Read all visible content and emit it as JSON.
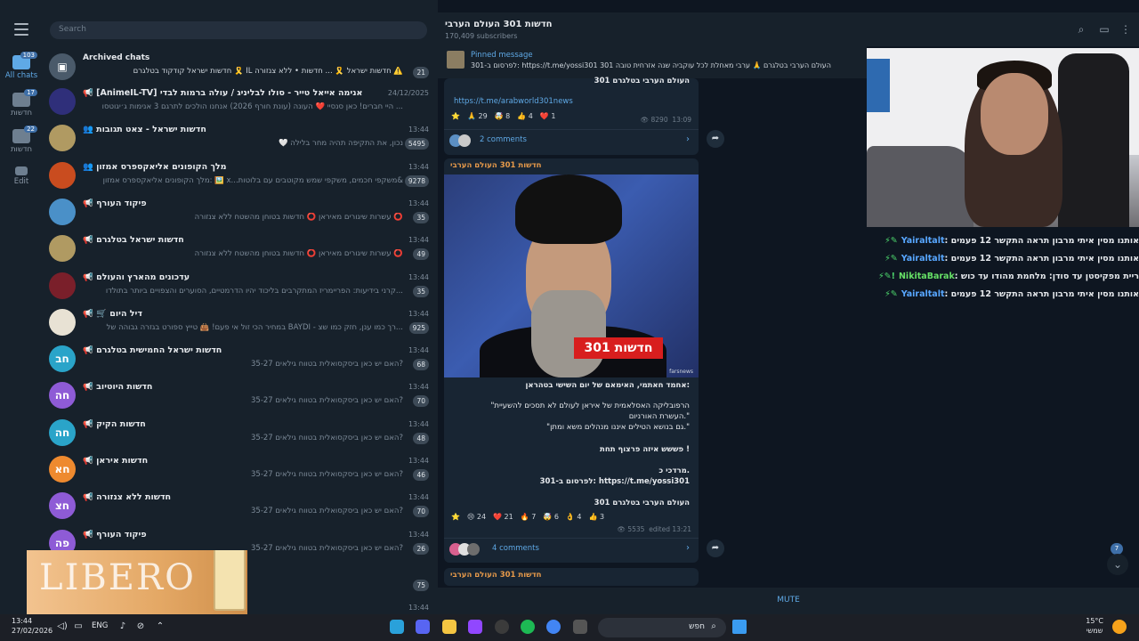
{
  "rail": {
    "folders": [
      {
        "label": "All chats",
        "badge": "103"
      },
      {
        "label": "חדשות",
        "badge": "17"
      },
      {
        "label": "חדשות",
        "badge": "22"
      },
      {
        "label": "Edit",
        "badge": ""
      }
    ]
  },
  "search": {
    "placeholder": "Search"
  },
  "archived": {
    "title": "Archived chats",
    "preview": "חדשות ישראל קודקוד בטלגרם 🎗️ IL חדשות ישראל 🎗️ ... חדשות • ללא צנזורה ⚠️",
    "badge": "21"
  },
  "chats": [
    {
      "title": "📢 [AnimeIL-TV] אנימה אייאל טייר - סולו לבליניג / עולה ברמות לבדי",
      "time": "24/12/2025",
      "preview": "היי חברים! כאן סנסיי ❤️ העונה (עונת חורף 2026) אנחנו הולכים לתרגם 3 אנימות ג׳יגוטסו ...",
      "badge": "",
      "avatar_text": "",
      "avatar_color": "#2f2f7a"
    },
    {
      "title": "👥 חדשות ישראל - צאט תגובות",
      "time": "13:44",
      "preview": "🤍 נכון, את התקיפה תהיה מחר בלילה",
      "badge": "5495",
      "avatar_text": "",
      "avatar_color": "#b09a62"
    },
    {
      "title": "👥 מלך הקופונים אליאקספרס אמזון",
      "time": "13:44",
      "preview": "מלך הקופונים אליאקספרס אמזון: 🖼️ x...משקפי חכמים, משקפי שמש מקוטבים עם בלוטות&",
      "badge": "9278",
      "avatar_text": "",
      "avatar_color": "#c94c1f"
    },
    {
      "title": "📢 פיקוד העורף",
      "time": "13:44",
      "preview": "עשרות שיגורים מאיראן ⭕ חדשות בטוחן מהשטח ללא צנזורה ⭕",
      "badge": "35",
      "avatar_text": "",
      "avatar_color": "#4a90c8"
    },
    {
      "title": "📢 חדשות ישראל בטלגרם",
      "time": "13:44",
      "preview": "עשרות שיגורים מאיראן ⭕ חדשות בטוחן מהשטח ללא צנזורה ⭕",
      "badge": "49",
      "avatar_text": "",
      "avatar_color": "#b09a62"
    },
    {
      "title": "📢 עדכונים מהארץ והעולם",
      "time": "13:44",
      "preview": "קרני בידיעות: הפריימריז המתקרבים בליכוד יהיו הדרמטיים, הסוערים והצפויים ביותר בתולדו...",
      "badge": "35",
      "avatar_text": "",
      "avatar_color": "#7a1f2a"
    },
    {
      "title": "📢 🛒 דיל היום",
      "time": "13:44",
      "preview": "במחיר הכי זול אי פעם! 👜 טייץ ספורט בגזרה גבוהה של BAYDI - רך כמו ענן, חזק כמו שצ...",
      "badge": "925",
      "avatar_text": "",
      "avatar_color": "#e8e2d4"
    },
    {
      "title": "📢 חדשות ישראל החמישית בטלגרם",
      "time": "13:44",
      "preview": "האם יש כאן ביסקסואלית בטווח גילאים 35-27?",
      "badge": "68",
      "avatar_text": "חב",
      "avatar_color": "#2aa4c9"
    },
    {
      "title": "📢 חדשות היוטיוב",
      "time": "13:44",
      "preview": "האם יש כאן ביסקסואלית בטווח גילאים 35-27?",
      "badge": "70",
      "avatar_text": "חה",
      "avatar_color": "#8e5bd6"
    },
    {
      "title": "📢 חדשות הקיק",
      "time": "13:44",
      "preview": "האם יש כאן ביסקסואלית בטווח גילאים 35-27?",
      "badge": "48",
      "avatar_text": "חה",
      "avatar_color": "#2aa4c9"
    },
    {
      "title": "📢 חדשות איראן",
      "time": "13:44",
      "preview": "האם יש כאן ביסקסואלית בטווח גילאים 35-27?",
      "badge": "46",
      "avatar_text": "חא",
      "avatar_color": "#ee8a2f"
    },
    {
      "title": "📢 חדשות ללא צנזורה",
      "time": "13:44",
      "preview": "האם יש כאן ביסקסואלית בטווח גילאים 35-27?",
      "badge": "70",
      "avatar_text": "חצ",
      "avatar_color": "#8e5bd6"
    },
    {
      "title": "📢 פיקוד העורף",
      "time": "13:44",
      "preview": "האם יש כאן ביסקסואלית בטווח גילאים 35-27?",
      "badge": "26",
      "avatar_text": "פה",
      "avatar_color": "#8e5bd6"
    },
    {
      "title": "",
      "time": "",
      "preview": "",
      "badge": "75",
      "avatar_text": "",
      "avatar_color": "#17212b"
    },
    {
      "title": "",
      "time": "13:44",
      "preview": "",
      "badge": "",
      "avatar_text": "",
      "avatar_color": "#17212b"
    }
  ],
  "channel": {
    "title": "חדשות 301 העולם הערבי",
    "subscribers": "170,409 subscribers",
    "pinned_label": "Pinned message",
    "pinned_text": "לפרסום ב-301: https://t.me/yossi301 301 העולם הערבי בטלגרם 🙏 ערבי מאחלת לכל עוקביה שנה אזרחית טובה",
    "pinned_line2": "301 העולם הערבי בטלגרם",
    "msg1": {
      "link": "https://t.me/arabworld301news",
      "reactions": [
        "⭐",
        "🙏 29",
        "🤯 8",
        "👍 4",
        "❤️ 1"
      ],
      "views": "👁 8290",
      "time": "13:09",
      "comments": "2 comments"
    },
    "msg2": {
      "author": "חדשות 301 העולם הערבי",
      "photo_label": "חדשות 301",
      "photo_watermark": "farsnews",
      "lines": [
        "אחמד חאתמי, האימאם של יום השישי בטהראן:",
        "\"הרפובליקה האסלאמית של איראן לעולם לא תסכים להשעיית",
        "העשרת האורניום.\"",
        "\"גם בנושא הטילים איננו מנהלים משא ומתן.\"",
        "פששש איזה פרצוף תחת !",
        "מרדכי כ.",
        "לפרסום ב-301: https://t.me/yossi301",
        "301 העולם הערבי בטלגרם"
      ],
      "reactions": [
        "⭐",
        "😢 24",
        "❤️ 21",
        "🔥 7",
        "🤯 6",
        "👌 4",
        "👍 3"
      ],
      "views": "👁 5535",
      "edited": "edited 13:21",
      "comments": "4 comments"
    },
    "msg3_author": "חדשות 301 העולם הערבי",
    "mute": "MUTE",
    "unread_badge": "7"
  },
  "stream_chat": [
    {
      "nick": "Yairaltalt",
      "text": ": אותנו מסין איתי מרבון תראה התקשר 12 פעמים",
      "green": false
    },
    {
      "nick": "Yairaltalt",
      "text": ": אותנו מסין איתי מרבון תראה התקשר 12 פעמים",
      "green": false
    },
    {
      "nick": "NikitaBarak",
      "text": ": ריית מפקיסטן עד סודן: מלחמת מהודו עד כוש",
      "green": true
    },
    {
      "nick": "Yairaltalt",
      "text": ": אותנו מסין איתי מרבון תראה התקשר 12 פעמים",
      "green": false
    }
  ],
  "ad": {
    "brand": "LIBERO"
  },
  "taskbar": {
    "time": "13:44",
    "date": "27/02/2026",
    "lang": "ENG",
    "search": "חפש",
    "temp": "15°C",
    "weather": "שמשי"
  },
  "colors": {
    "accent": "#5fa9e6",
    "panel": "#17212b",
    "background": "#0e1621",
    "badge_red": "#d81e1e"
  }
}
